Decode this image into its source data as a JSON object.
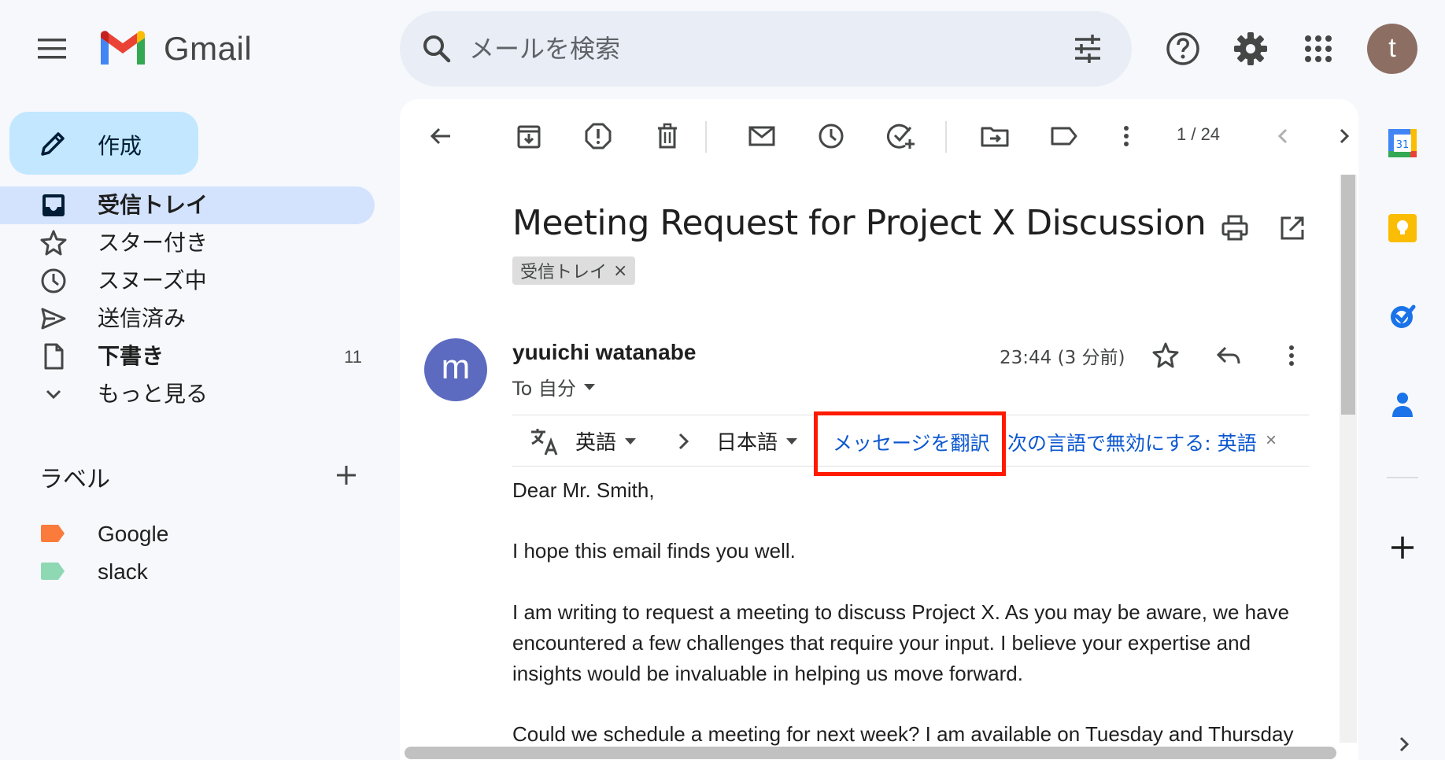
{
  "app": {
    "name": "Gmail"
  },
  "search": {
    "placeholder": "メールを検索"
  },
  "account": {
    "initial": "t",
    "avatar_color": "#8d6e63"
  },
  "compose": {
    "label": "作成"
  },
  "nav": {
    "items": [
      {
        "label": "受信トレイ",
        "icon": "inbox-icon",
        "active": true
      },
      {
        "label": "スター付き",
        "icon": "star-icon"
      },
      {
        "label": "スヌーズ中",
        "icon": "clock-icon"
      },
      {
        "label": "送信済み",
        "icon": "send-icon"
      },
      {
        "label": "下書き",
        "icon": "draft-icon",
        "count": "11"
      },
      {
        "label": "もっと見る",
        "icon": "chevron-down-icon"
      }
    ]
  },
  "labels": {
    "title": "ラベル",
    "items": [
      {
        "name": "Google",
        "color": "#fa7b3c"
      },
      {
        "name": "slack",
        "color": "#8fd8b4"
      }
    ]
  },
  "toolbar": {
    "pager": "1 / 24"
  },
  "email": {
    "subject": "Meeting Request for Project X Discussion",
    "chip": "受信トレイ",
    "sender_initial": "m",
    "sender_name": "yuuichi watanabe",
    "to": "To 自分",
    "time": "23:44 (3 分前)",
    "body": [
      "Dear Mr. Smith,",
      "I hope this email finds you well.",
      "I am writing to request a meeting to discuss Project X. As you may be aware, we have",
      "encountered a few challenges that require your input. I believe your expertise and",
      "insights would be invaluable in helping us move forward.",
      "Could we schedule a meeting for next week? I am available on Tuesday and Thursday"
    ]
  },
  "translation": {
    "source_lang": "英語",
    "target_lang": "日本語",
    "translate_link": "メッセージを翻訳",
    "disable_link": "次の言語で無効にする: 英語",
    "close": "×"
  },
  "colors": {
    "accent_link": "#0b57d0",
    "highlight": "#ff1a00",
    "nav_active": "#d3e3fd",
    "compose_bg": "#c2e7ff",
    "sender_avatar": "#5c6bc0"
  }
}
